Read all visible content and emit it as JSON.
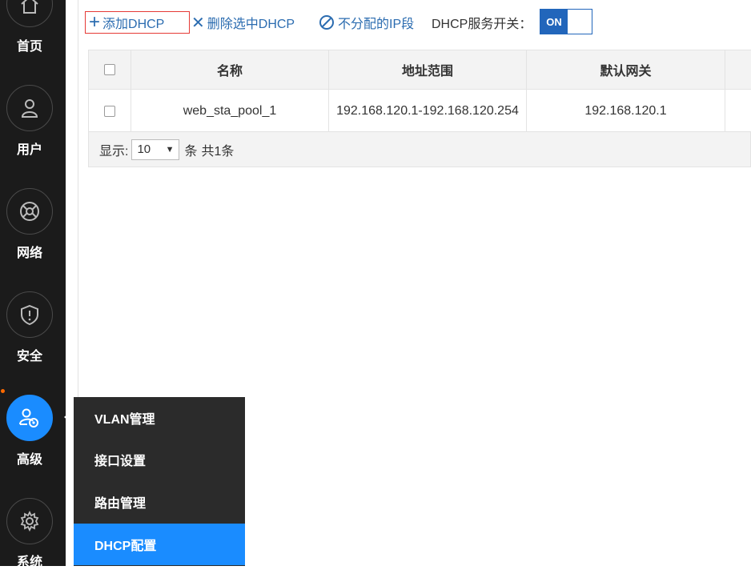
{
  "sidebar": {
    "items": [
      {
        "label": "首页",
        "icon": "home-icon"
      },
      {
        "label": "用户",
        "icon": "user-icon"
      },
      {
        "label": "网络",
        "icon": "network-icon"
      },
      {
        "label": "安全",
        "icon": "shield-icon"
      },
      {
        "label": "高级",
        "icon": "advanced-users-icon",
        "active": true
      },
      {
        "label": "系统",
        "icon": "gear-icon"
      }
    ]
  },
  "toolbar": {
    "add_label": "添加DHCP",
    "delete_label": "删除选中DHCP",
    "exclude_label": "不分配的IP段",
    "service_label": "DHCP服务开关：",
    "toggle_label": "ON"
  },
  "table": {
    "columns": [
      "",
      "名称",
      "地址范围",
      "默认网关"
    ],
    "rows": [
      {
        "name": "web_sta_pool_1",
        "range": "192.168.120.1-192.168.120.254",
        "gateway": "192.168.120.1"
      }
    ]
  },
  "pagination": {
    "show_label": "显示:",
    "page_size": "10",
    "unit_label": "条",
    "total_label": "共1条"
  },
  "submenu": {
    "items": [
      {
        "label": "VLAN管理"
      },
      {
        "label": "接口设置"
      },
      {
        "label": "路由管理"
      },
      {
        "label": "DHCP配置",
        "active": true
      }
    ]
  },
  "colors": {
    "accent": "#1a8cff",
    "sidebar_bg": "#1b1b1b",
    "link": "#2b6cb0",
    "toggle": "#2266bb"
  }
}
